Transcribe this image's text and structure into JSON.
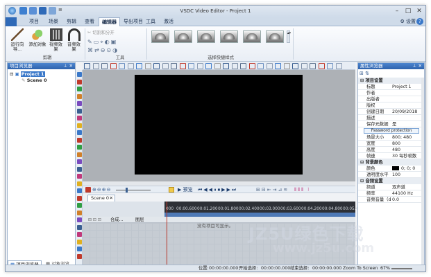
{
  "window": {
    "title": "VSDC Video Editor - Project 1"
  },
  "ribbon": {
    "tabs": [
      "项目",
      "场景",
      "剪辑",
      "查看",
      "编辑器",
      "导出项目",
      "工具",
      "激活"
    ],
    "active_tab": "编辑器",
    "settings_label": "设置",
    "help_label": "?",
    "buttons": {
      "wizard": "运行向导...",
      "add_object": "添加对象",
      "video_effects": "视频效果",
      "audio_effects": "音频效果"
    },
    "tools_items": {
      "cut": "切割和分开"
    },
    "groups": {
      "editing": "剪辑",
      "tools": "工具",
      "quick_styles": "选择快捷样式"
    }
  },
  "project_explorer": {
    "title": "项目浏览器",
    "project": "Project 1",
    "scene": "Scene 0",
    "bottom_tabs": [
      "项目浏览器",
      "对象浏览器"
    ]
  },
  "playback": {
    "preview_label": "预览"
  },
  "timeline": {
    "scene_tab": "Scene 0",
    "header_label": "合成...",
    "layer_label": "图层",
    "empty_message": "没有项目可显示。",
    "ticks": [
      "000",
      "00:00.600",
      "00:01.200",
      "00:01.800",
      "00:02.400",
      "00:03.000",
      "00:03.600",
      "00:04.200",
      "00:04.800",
      "00:05.40"
    ]
  },
  "properties": {
    "title": "属性浏览器",
    "section_project": "项目设置",
    "rows": [
      {
        "key": "标题",
        "value": "Project 1"
      },
      {
        "key": "作者",
        "value": ""
      },
      {
        "key": "出版者",
        "value": ""
      },
      {
        "key": "版权",
        "value": ""
      },
      {
        "key": "创建日期",
        "value": "20/09/2018"
      },
      {
        "key": "描述",
        "value": ""
      },
      {
        "key": "保存元数据",
        "value": "是"
      }
    ],
    "password_button": "Password protection",
    "size_rows": [
      {
        "key": "场景大小",
        "value": "800; 480"
      },
      {
        "key": "宽度",
        "value": "800"
      },
      {
        "key": "高度",
        "value": "480"
      },
      {
        "key": "帧速",
        "value": "30 每秒帧数"
      }
    ],
    "section_bg": "背景颜色",
    "bg_rows": [
      {
        "key": "颜色",
        "value": "0; 0; 0"
      },
      {
        "key": "透明度水平",
        "value": "100"
      }
    ],
    "section_audio": "音频设置",
    "audio_rows": [
      {
        "key": "频道",
        "value": "双声道"
      },
      {
        "key": "频率",
        "value": "44100 Hz"
      },
      {
        "key": "音频音量（d",
        "value": "0.0"
      }
    ]
  },
  "status": {
    "position_label": "位置:",
    "position_value": "00:00:00.000",
    "start_label": "开始选择:",
    "start_value": "00:00:00.000",
    "end_label": "结束选择:",
    "end_value": "00:00:00.000",
    "zoom_label": "Zoom To Screen",
    "zoom_value": "67%"
  },
  "watermark": {
    "line1": "JZ5U绿色下载",
    "line2": "www.jz5u.com"
  },
  "colors": {
    "accent": "#3a78c9",
    "panel_header": "#2e63ad",
    "canvas": "#000000",
    "playhead": "#c0392b"
  }
}
